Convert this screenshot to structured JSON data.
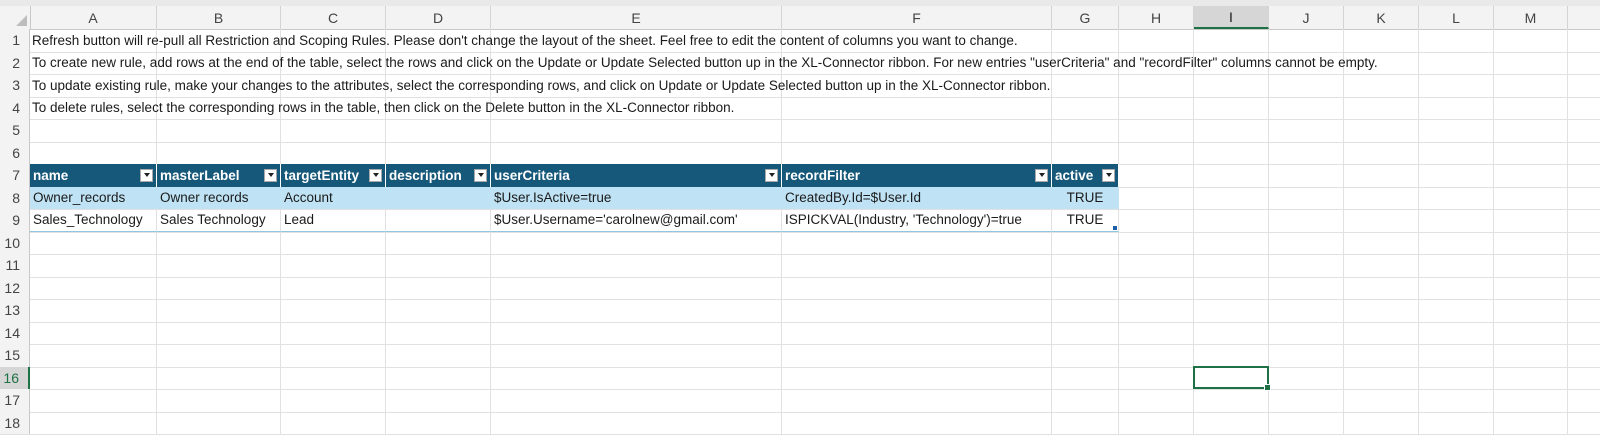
{
  "sheet": {
    "columns": [
      "A",
      "B",
      "C",
      "D",
      "E",
      "F",
      "G",
      "H",
      "I",
      "J",
      "K",
      "L",
      "M"
    ],
    "selected_column": "I",
    "row_numbers": [
      "1",
      "2",
      "3",
      "4",
      "5",
      "6",
      "7",
      "8",
      "9",
      "10",
      "11",
      "12",
      "13",
      "14",
      "15",
      "16",
      "17",
      "18"
    ],
    "selected_row": "16",
    "notes": [
      "Refresh button will re-pull all Restriction and Scoping Rules. Please don't change the layout of the sheet. Feel free to edit the content of columns you want to change.",
      "To create new rule, add rows at the end of the table, select the rows and click on the Update or Update Selected button up in the XL-Connector ribbon. For new entries \"userCriteria\" and \"recordFilter\" columns cannot be empty.",
      "To update existing rule, make your changes to the attributes, select the corresponding rows, and click on Update or Update Selected button up in the XL-Connector ribbon.",
      "To delete rules, select the corresponding rows in the table, then click on the Delete button in the XL-Connector ribbon."
    ],
    "active_cell": "I16"
  },
  "table": {
    "headers": [
      "name",
      "masterLabel",
      "targetEntity",
      "description",
      "userCriteria",
      "recordFilter",
      "active"
    ],
    "rows": [
      [
        "Owner_records",
        "Owner records",
        "Account",
        "",
        "$User.IsActive=true",
        "CreatedBy.Id=$User.Id",
        "TRUE"
      ],
      [
        "Sales_Technology",
        "Sales Technology",
        "Lead",
        "",
        "$User.Username='carolnew@gmail.com'",
        "ISPICKVAL(Industry, 'Technology')=true",
        "TRUE"
      ]
    ]
  },
  "icons": {
    "filter_dropdown": "chevron-down-icon",
    "corner": "select-all-icon"
  },
  "colors": {
    "table_header": "#16587a",
    "band_row": "#bfe3f4",
    "selection": "#1e7145"
  }
}
